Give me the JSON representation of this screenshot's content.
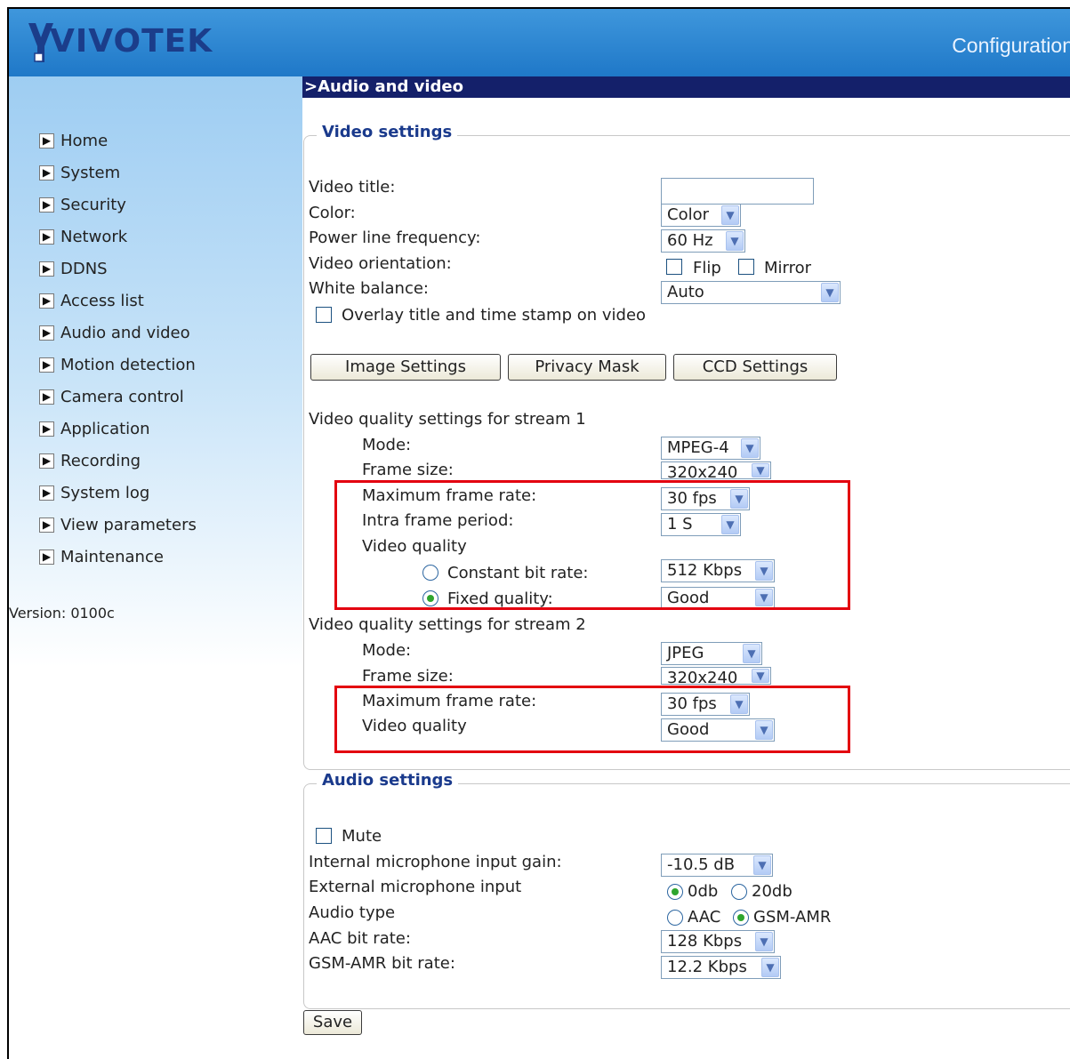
{
  "brand": {
    "logo_text": "VIVOTEK",
    "header_title": "Configuration"
  },
  "nav": [
    "Home",
    "System",
    "Security",
    "Network",
    "DDNS",
    "Access list",
    "Audio and video",
    "Motion detection",
    "Camera control",
    "Application",
    "Recording",
    "System log",
    "View parameters",
    "Maintenance"
  ],
  "version": "Version: 0100c",
  "page_title": ">Audio and video",
  "video": {
    "legend": "Video settings",
    "title_label": "Video title:",
    "title_value": "",
    "color_label": "Color:",
    "color_value": "Color",
    "power_label": "Power line frequency:",
    "power_value": "60 Hz",
    "orientation_label": "Video orientation:",
    "flip_label": "Flip",
    "mirror_label": "Mirror",
    "wb_label": "White balance:",
    "wb_value": "Auto",
    "overlay_label": "Overlay title and time stamp on video",
    "buttons": {
      "image": "Image Settings",
      "privacy": "Privacy Mask",
      "ccd": "CCD Settings"
    },
    "stream1": {
      "heading": "Video quality settings for stream 1",
      "mode_label": "Mode:",
      "mode_value": "MPEG-4",
      "frame_label": "Frame size:",
      "frame_value": "320x240",
      "maxfr_label": "Maximum frame rate:",
      "maxfr_value": "30 fps",
      "intra_label": "Intra frame period:",
      "intra_value": "1 S",
      "vq_label": "Video quality",
      "cbr_label": "Constant bit rate:",
      "cbr_value": "512 Kbps",
      "fixed_label": "Fixed quality:",
      "fixed_value": "Good"
    },
    "stream2": {
      "heading": "Video quality settings for stream 2",
      "mode_label": "Mode:",
      "mode_value": "JPEG",
      "frame_label": "Frame size:",
      "frame_value": "320x240",
      "maxfr_label": "Maximum frame rate:",
      "maxfr_value": "30 fps",
      "vq_label": "Video quality",
      "vq_value": "Good"
    }
  },
  "audio": {
    "legend": "Audio settings",
    "mute_label": "Mute",
    "int_gain_label": "Internal microphone input gain:",
    "int_gain_value": "-10.5 dB",
    "ext_label": "External microphone input",
    "ext_0db": "0db",
    "ext_20db": "20db",
    "type_label": "Audio type",
    "type_aac": "AAC",
    "type_gsm": "GSM-AMR",
    "aac_label": "AAC bit rate:",
    "aac_value": "128 Kbps",
    "gsm_label": "GSM-AMR bit rate:",
    "gsm_value": "12.2 Kbps"
  },
  "save_label": "Save"
}
